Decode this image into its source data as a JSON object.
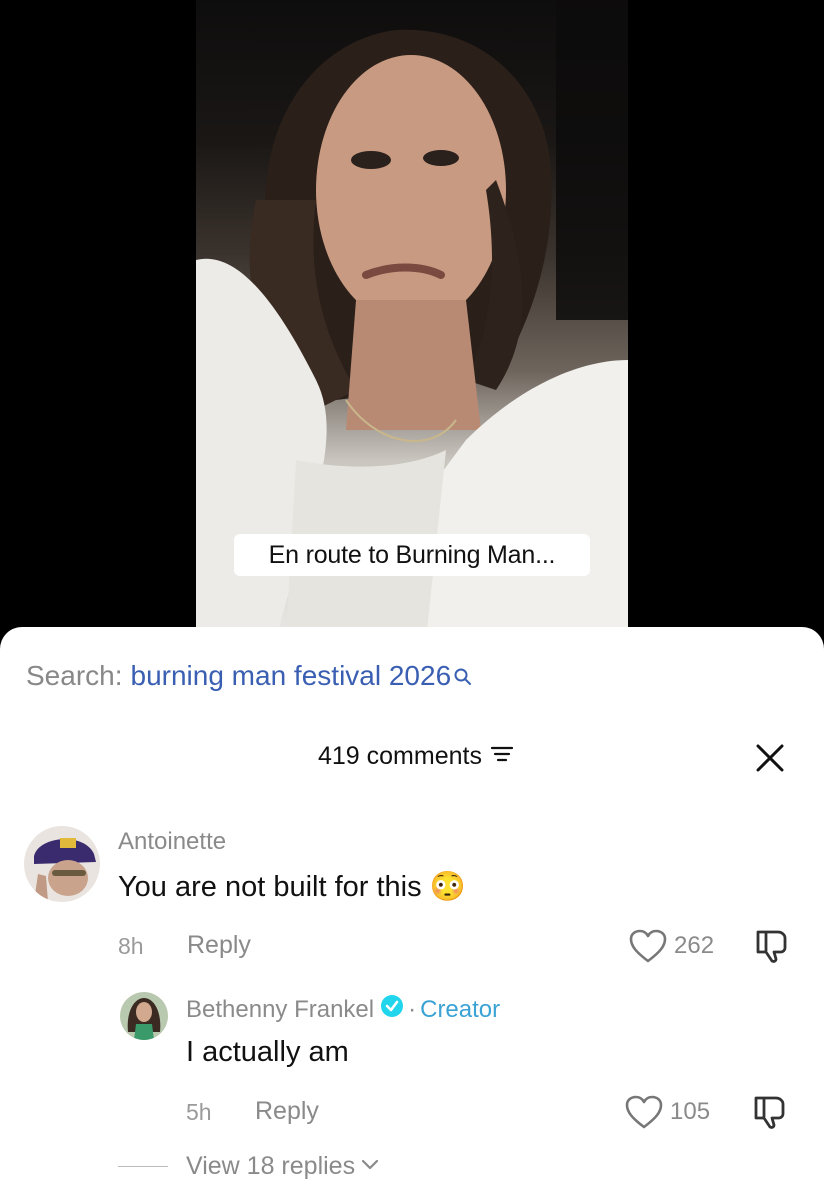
{
  "video": {
    "caption": "En route to Burning Man..."
  },
  "search": {
    "prefix": "Search:",
    "query": "burning man festival 2026"
  },
  "comments_header": {
    "count_label": "419 comments"
  },
  "comments": [
    {
      "username": "Antoinette",
      "text": "You are not built for this 😳",
      "time": "8h",
      "reply_label": "Reply",
      "likes": "262"
    }
  ],
  "reply": {
    "username": "Bethenny Frankel",
    "separator": "·",
    "creator_label": "Creator",
    "text": "I actually am",
    "time": "5h",
    "reply_label": "Reply",
    "likes": "105"
  },
  "view_replies_label": "View 18 replies",
  "colors": {
    "search_query": "#3a5fb2",
    "creator": "#3aa3d4",
    "verified": "#20d5ec"
  }
}
